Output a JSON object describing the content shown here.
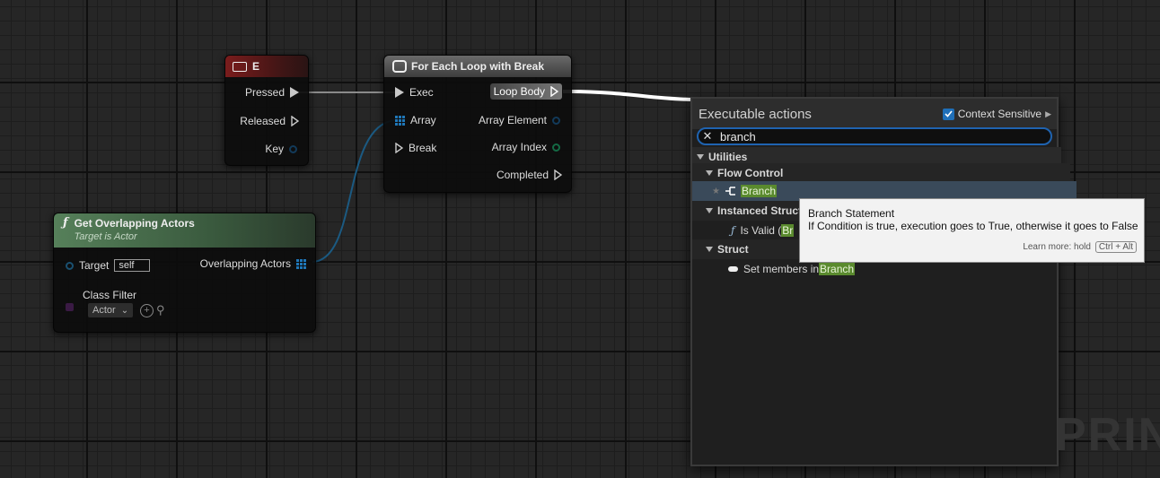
{
  "nodes": {
    "key_event": {
      "title": "E",
      "pins": [
        "Pressed",
        "Released",
        "Key"
      ]
    },
    "for_each": {
      "title": "For Each Loop with Break",
      "inputs": [
        "Exec",
        "Array",
        "Break"
      ],
      "outputs": [
        "Loop Body",
        "Array Element",
        "Array Index",
        "Completed"
      ]
    },
    "get_overlapping": {
      "title": "Get Overlapping Actors",
      "subtitle": "Target is Actor",
      "target_label": "Target",
      "target_value": "self",
      "output_label": "Overlapping Actors",
      "class_filter_label": "Class Filter",
      "class_filter_value": "Actor"
    }
  },
  "menu": {
    "title": "Executable actions",
    "context_sensitive": "Context Sensitive",
    "search_value": "branch",
    "categories": {
      "utilities": "Utilities",
      "flow_control": "Flow Control",
      "branch": "Branch",
      "instanced_struct": "Instanced Struct",
      "is_valid_prefix": "Is Valid (",
      "is_valid_hl": "Br",
      "struct": "Struct",
      "set_members_prefix": "Set members in ",
      "set_members_hl": "Branch"
    }
  },
  "tooltip": {
    "title": "Branch Statement",
    "body": "If Condition is true, execution goes to True, otherwise it goes to False",
    "learn_more": "Learn more: hold",
    "shortcut": "Ctrl + Alt"
  },
  "watermark": "PRINT",
  "colors": {
    "exec_wire": "#ffffff",
    "data_wire": "#1f6fa0",
    "search_border": "#1f63b0",
    "highlight": "#5a8a2e"
  }
}
